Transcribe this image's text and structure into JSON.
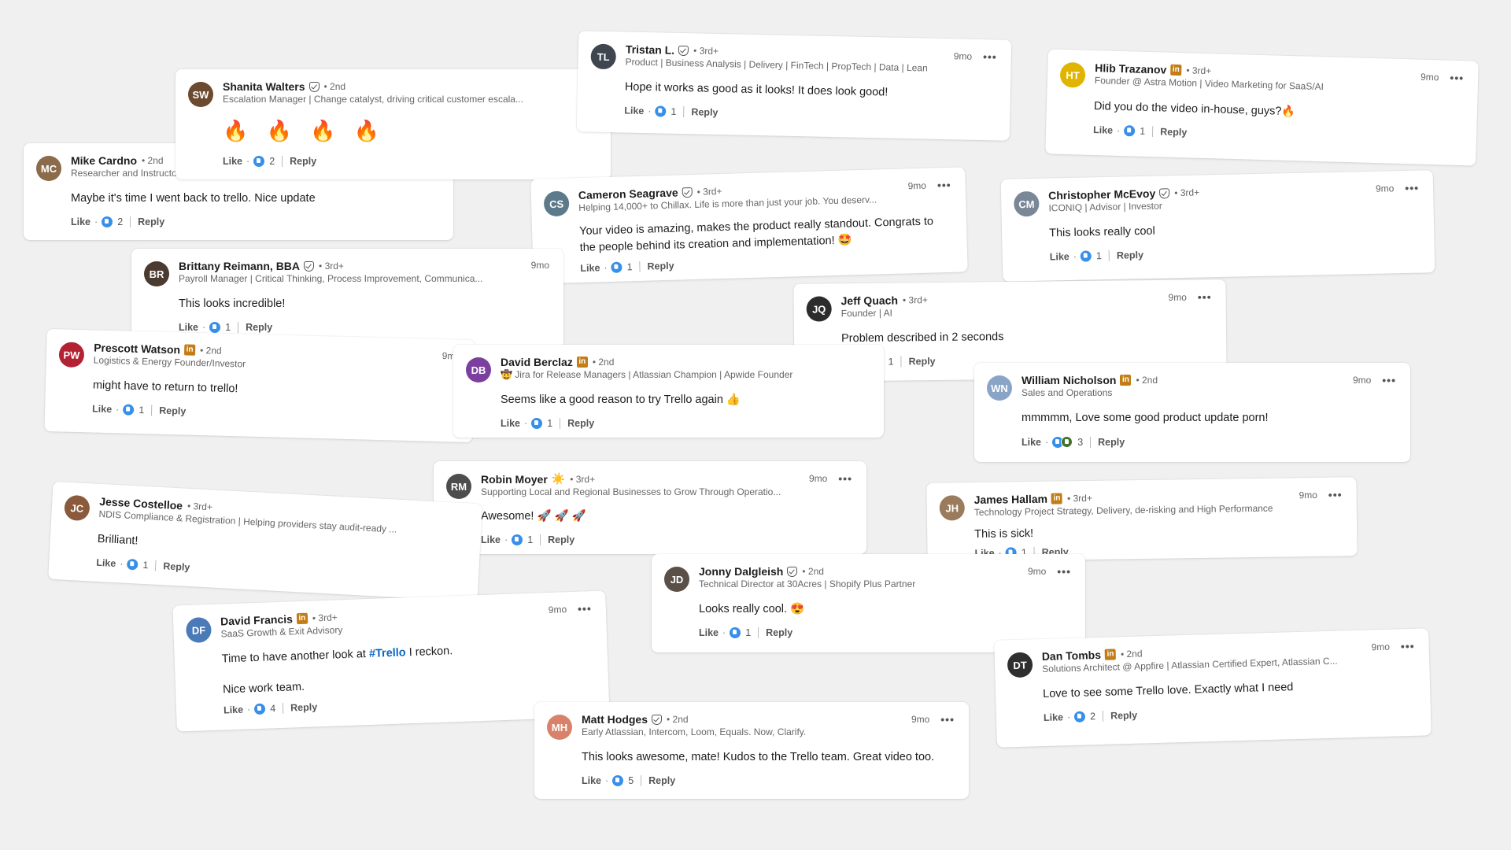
{
  "ui": {
    "like_label": "Like",
    "reply_label": "Reply",
    "time": "9mo",
    "more": "•••"
  },
  "comments": {
    "shanita": {
      "name": "Shanita Walters",
      "degree": "• 2nd",
      "headline": "Escalation Manager | Change catalyst, driving critical customer escala...",
      "text": "🔥 🔥 🔥 🔥",
      "likes": "2",
      "avatar_color": "#6b4a2f"
    },
    "mike": {
      "name": "Mike Cardno",
      "degree": "• 2nd",
      "headline": "Researcher and Instructor",
      "text": "Maybe it's time I went back to trello. Nice update",
      "likes": "2",
      "avatar_color": "#8b6b4a"
    },
    "tristan": {
      "name": "Tristan L.",
      "degree": "• 3rd+",
      "headline": "Product | Business Analysis | Delivery | FinTech | PropTech | Data | Lean",
      "text": "Hope it works as good as it looks! It does look good!",
      "likes": "1",
      "avatar_color": "#3f4650"
    },
    "hlib": {
      "name": "Hlib Trazanov",
      "degree": "• 3rd+",
      "headline": "Founder @ Astra Motion | Video Marketing for SaaS/AI",
      "text": "Did you do the video in-house, guys?",
      "text_emoji": "🔥",
      "likes": "1",
      "avatar_color": "#e0b400"
    },
    "cameron": {
      "name": "Cameron Seagrave",
      "degree": "• 3rd+",
      "headline": "Helping 14,000+ to Chillax. Life is more than just your job. You deserv...",
      "text": "Your video is amazing, makes the product really standout. Congrats to the people behind its creation and implementation! 🤩",
      "likes": "1",
      "avatar_color": "#5c7a8a"
    },
    "christopher": {
      "name": "Christopher McEvoy",
      "degree": "• 3rd+",
      "headline": "ICONIQ | Advisor | Investor",
      "text": "This looks really cool",
      "likes": "1",
      "avatar_color": "#7a8796"
    },
    "brittany": {
      "name": "Brittany Reimann, BBA",
      "degree": "• 3rd+",
      "headline": "Payroll Manager | Critical Thinking, Process Improvement, Communica...",
      "text": "This looks incredible!",
      "likes": "1",
      "avatar_color": "#4a3a30"
    },
    "jeff": {
      "name": "Jeff Quach",
      "degree": "• 3rd+",
      "headline": "Founder | AI",
      "text": "Problem described in 2 seconds",
      "likes": "1",
      "avatar_color": "#2c2c2c"
    },
    "prescott": {
      "name": "Prescott Watson",
      "degree": "• 2nd",
      "headline": "Logistics & Energy Founder/Investor",
      "text": "might have to return to trello!",
      "likes": "1",
      "avatar_color": "#b22234"
    },
    "david_b": {
      "name": "David Berclaz",
      "degree": "• 2nd",
      "headline": "🤠 Jira for Release Managers | Atlassian Champion | Apwide Founder",
      "text": "Seems like a good reason to try Trello again 👍",
      "likes": "1",
      "avatar_color": "#7b3fa0"
    },
    "william": {
      "name": "William Nicholson",
      "degree": "• 2nd",
      "headline": "Sales and Operations",
      "text": "mmmmm, Love some good product update porn!",
      "likes": "3",
      "avatar_color": "#8aa4c8"
    },
    "robin": {
      "name": "Robin Moyer",
      "degree": "• 3rd+",
      "headline": "Supporting Local and Regional Businesses to Grow Through Operatio...",
      "text": "Awesome! 🚀 🚀 🚀",
      "likes": "1",
      "avatar_color": "#4d4d4d"
    },
    "jesse": {
      "name": "Jesse Costelloe",
      "degree": "• 3rd+",
      "headline": "NDIS Compliance & Registration | Helping providers stay audit-ready ...",
      "text": "Brilliant!",
      "likes": "1",
      "avatar_color": "#8a5a3c"
    },
    "james": {
      "name": "James Hallam",
      "degree": "• 3rd+",
      "headline": "Technology Project Strategy, Delivery, de-risking and High Performance",
      "text": "This is sick!",
      "likes": "1",
      "avatar_color": "#9a7b5c"
    },
    "jonny": {
      "name": "Jonny Dalgleish",
      "degree": "• 2nd",
      "headline": "Technical Director at 30Acres | Shopify Plus Partner",
      "text": "Looks really cool. 😍",
      "likes": "1",
      "avatar_color": "#5a5048"
    },
    "david_f": {
      "name": "David Francis",
      "degree": "• 3rd+",
      "headline": "SaaS Growth & Exit Advisory",
      "text_before": "Time to have another look at ",
      "hashtag": "#Trello",
      "text_after": " I reckon.",
      "text2": "Nice work team.",
      "likes": "4",
      "avatar_color": "#4a7ab8"
    },
    "dan": {
      "name": "Dan Tombs",
      "degree": "• 2nd",
      "headline": "Solutions Architect @ Appfire | Atlassian Certified Expert, Atlassian C...",
      "text": "Love to see some Trello love. Exactly what I need",
      "likes": "2",
      "avatar_color": "#2f2f2f"
    },
    "matt": {
      "name": "Matt Hodges",
      "degree": "• 2nd",
      "headline": "Early Atlassian, Intercom, Loom, Equals. Now, Clarify.",
      "text": "This looks awesome, mate! Kudos to the Trello team. Great video too.",
      "likes": "5",
      "avatar_color": "#d9826b"
    }
  }
}
